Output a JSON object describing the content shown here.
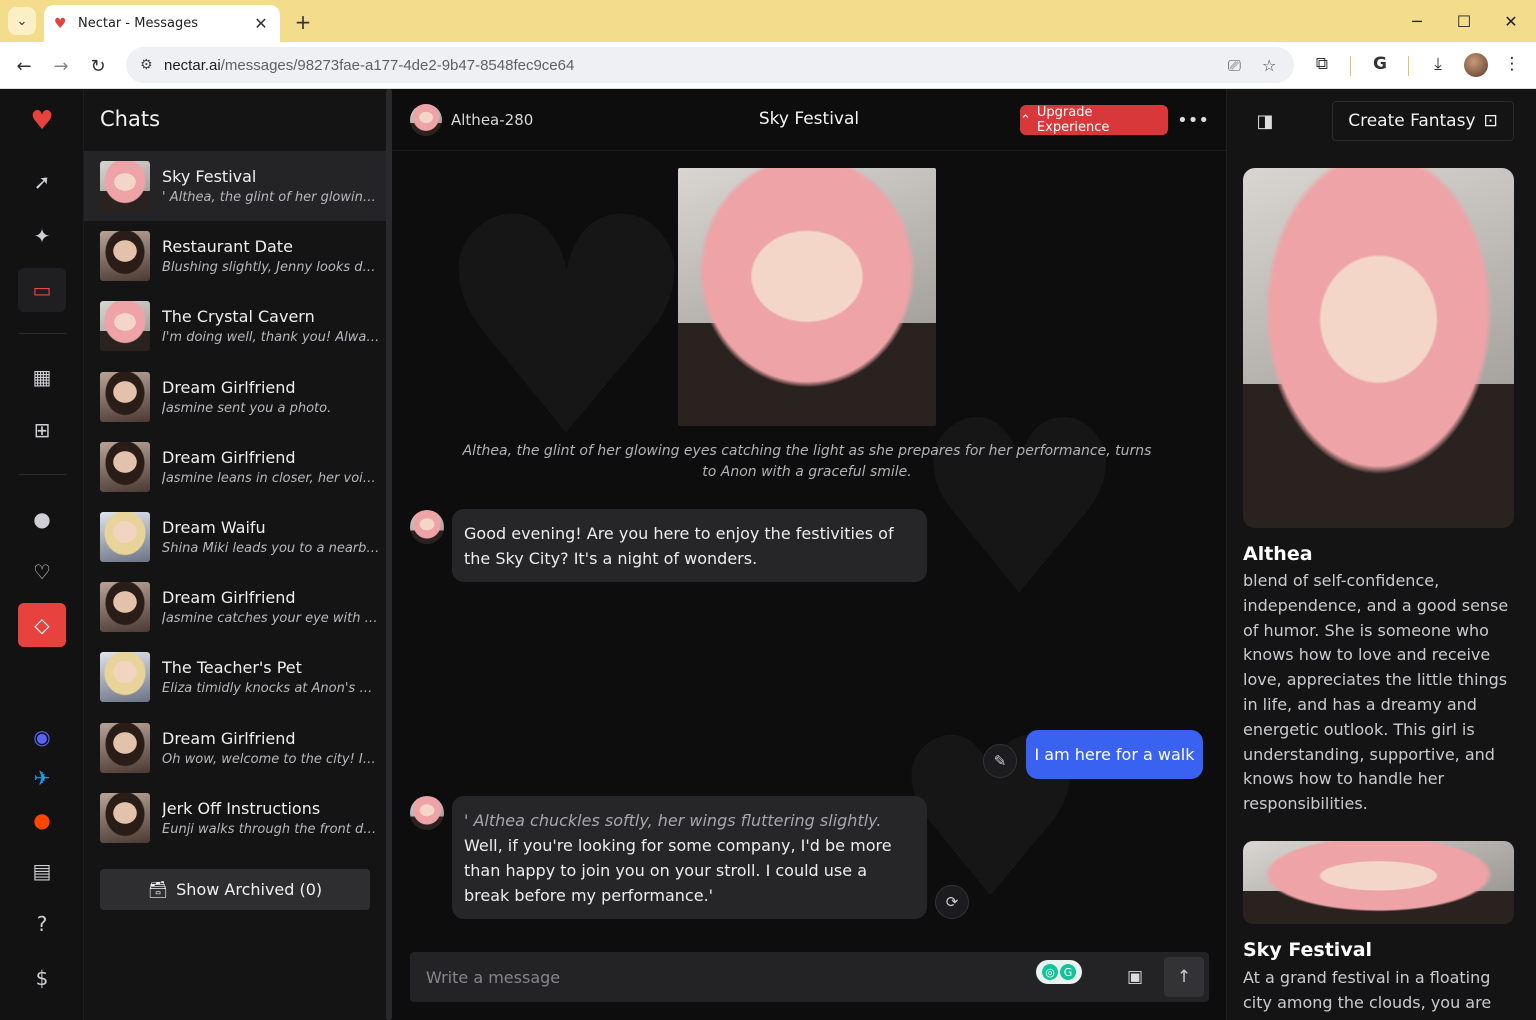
{
  "browser": {
    "tab_title": "Nectar - Messages",
    "url_host": "nectar.ai",
    "url_path": "/messages/98273fae-a177-4de2-9b47-8548fec9ce64"
  },
  "rail": {
    "items": [
      "logo-heart",
      "launch",
      "sparkle",
      "messages",
      "gallery",
      "create",
      "profile",
      "favorites",
      "premium",
      "discord",
      "twitter",
      "reddit",
      "news",
      "help",
      "billing"
    ]
  },
  "chats": {
    "title": "Chats",
    "items": [
      {
        "name": "Sky Festival",
        "preview": "' Althea, the glint of her glowing eyes catching the light as she prepares for her performance",
        "thumb": "pink"
      },
      {
        "name": "Restaurant Date",
        "preview": "Blushing slightly, Jenny looks down at her menu",
        "thumb": "dark"
      },
      {
        "name": "The Crystal Cavern",
        "preview": "I'm doing well, thank you! Always happy to explore",
        "thumb": "pink"
      },
      {
        "name": "Dream Girlfriend",
        "preview": "Jasmine sent you a photo.",
        "thumb": "dark"
      },
      {
        "name": "Dream Girlfriend",
        "preview": "Jasmine leans in closer, her voice soft",
        "thumb": "dark"
      },
      {
        "name": "Dream Waifu",
        "preview": "Shina Miki leads you to a nearby bench",
        "thumb": "blonde"
      },
      {
        "name": "Dream Girlfriend",
        "preview": "Jasmine catches your eye with a smile",
        "thumb": "dark"
      },
      {
        "name": "The Teacher's Pet",
        "preview": "Eliza timidly knocks at Anon's door",
        "thumb": "blonde"
      },
      {
        "name": "Dream Girlfriend",
        "preview": "Oh wow, welcome to the city! It's beautiful",
        "thumb": "dark"
      },
      {
        "name": "Jerk Off Instructions",
        "preview": "Eunji walks through the front door",
        "thumb": "dark"
      }
    ],
    "archived_label": "Show Archived (0)"
  },
  "conversation": {
    "character_handle": "Althea-280",
    "title": "Sky Festival",
    "upgrade_label": "Upgrade Experience",
    "scene_caption": "Althea, the glint of her glowing eyes catching the light as she prepares for her performance, turns to Anon with a graceful smile.",
    "messages": [
      {
        "from": "bot",
        "text": "Good evening! Are you here to enjoy the festivities of the Sky City? It's a night of wonders."
      },
      {
        "from": "user",
        "text": "I am here for a walk"
      },
      {
        "from": "bot",
        "action": "' Althea chuckles softly, her wings fluttering slightly.",
        "text": " Well, if you're looking for some company, I'd be more than happy to join you on your stroll. I could use a break before my performance.'"
      }
    ],
    "composer_placeholder": "Write a message"
  },
  "sidebar": {
    "create_label": "Create Fantasy",
    "character_name": "Althea",
    "character_desc": "blend of self-confidence, independence, and a good sense of humor. She is someone who knows how to love and receive love, appreciates the little things in life, and has a dreamy and energetic outlook. This girl is understanding, supportive, and knows how to handle her responsibilities.",
    "scenario_title": "Sky Festival",
    "scenario_desc": "At a grand festival in a floating city among the clouds, you are"
  },
  "colors": {
    "accent_red": "#e8423f",
    "user_bubble": "#3a62f0",
    "browser_frame": "#f3dd8c"
  }
}
